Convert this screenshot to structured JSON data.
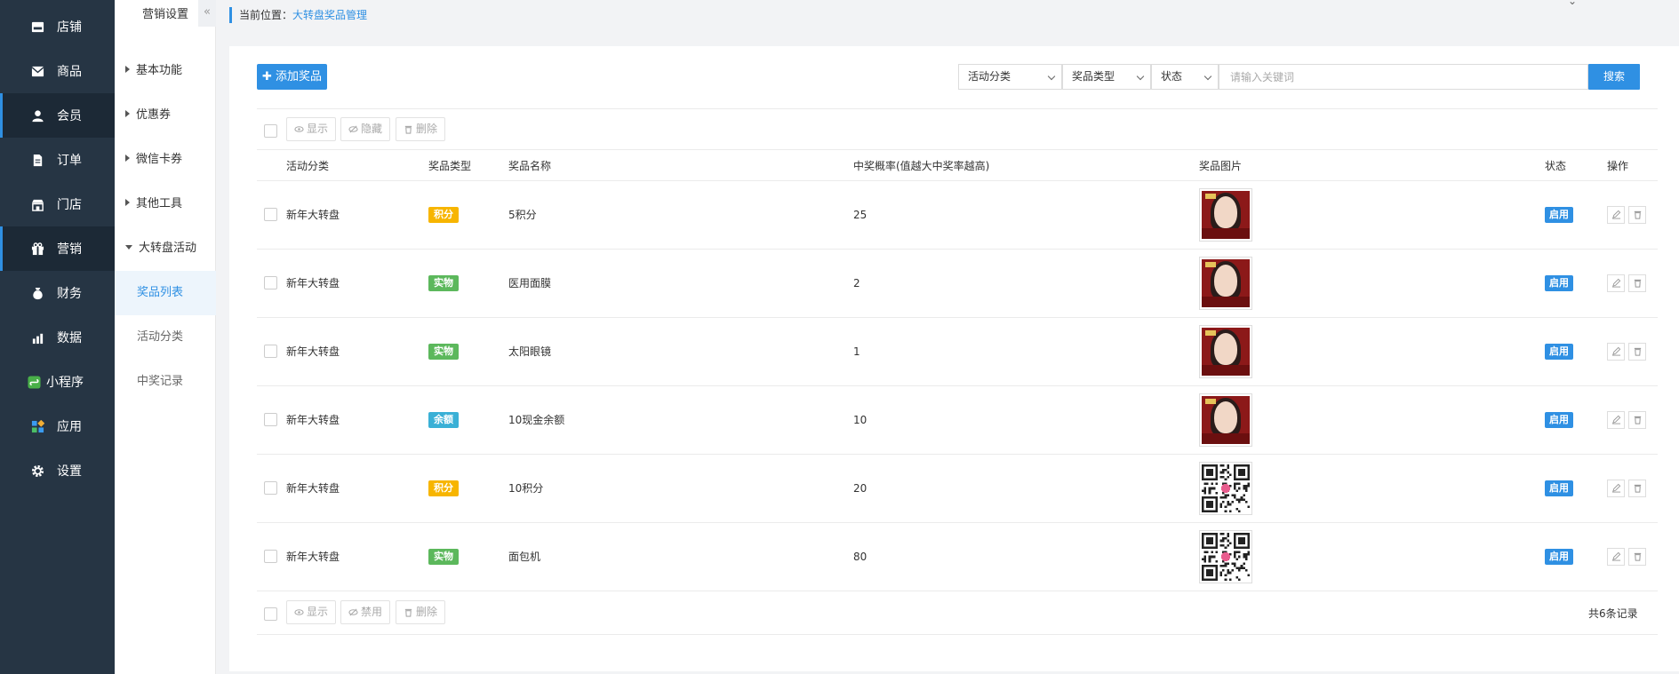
{
  "mainnav": [
    {
      "label": "店铺",
      "icon": "store-icon"
    },
    {
      "label": "商品",
      "icon": "goods-icon"
    },
    {
      "label": "会员",
      "icon": "member-icon"
    },
    {
      "label": "订单",
      "icon": "order-icon"
    },
    {
      "label": "门店",
      "icon": "shop-icon"
    },
    {
      "label": "营销",
      "icon": "gift-icon"
    },
    {
      "label": "财务",
      "icon": "money-bag-icon"
    },
    {
      "label": "数据",
      "icon": "chart-icon"
    },
    {
      "label": "小程序",
      "icon": "miniapp-icon"
    },
    {
      "label": "应用",
      "icon": "apps-icon"
    },
    {
      "label": "设置",
      "icon": "gear-icon"
    }
  ],
  "subnav": {
    "title": "营销设置",
    "collapse": "«",
    "groups": [
      "基本功能",
      "优惠券",
      "微信卡券",
      "其他工具",
      "大转盘活动"
    ],
    "leaves": [
      "奖品列表",
      "活动分类",
      "中奖记录"
    ]
  },
  "breadcrumb": {
    "prefix": "当前位置：",
    "current": "大转盘奖品管理"
  },
  "toolbar": {
    "add_label": "添加奖品",
    "filter_category": "活动分类",
    "filter_type": "奖品类型",
    "filter_status": "状态",
    "search_placeholder": "请输入关键词",
    "search_label": "搜索"
  },
  "batch_top": {
    "show": "显示",
    "hide": "隐藏",
    "delete": "删除"
  },
  "batch_bottom": {
    "show": "显示",
    "disable": "禁用",
    "delete": "删除"
  },
  "columns": {
    "category": "活动分类",
    "type": "奖品类型",
    "name": "奖品名称",
    "rate": "中奖概率(值越大中奖率越高)",
    "image": "奖品图片",
    "status": "状态",
    "actions": "操作"
  },
  "rows": [
    {
      "category": "新年大转盘",
      "type": "积分",
      "type_color": "#f7b500",
      "name": "5积分",
      "rate": "25",
      "image": "portrait",
      "status": "启用"
    },
    {
      "category": "新年大转盘",
      "type": "实物",
      "type_color": "#5cb85c",
      "name": "医用面膜",
      "rate": "2",
      "image": "portrait",
      "status": "启用"
    },
    {
      "category": "新年大转盘",
      "type": "实物",
      "type_color": "#5cb85c",
      "name": "太阳眼镜",
      "rate": "1",
      "image": "portrait",
      "status": "启用"
    },
    {
      "category": "新年大转盘",
      "type": "余额",
      "type_color": "#3ab0d6",
      "name": "10现金余额",
      "rate": "10",
      "image": "portrait",
      "status": "启用"
    },
    {
      "category": "新年大转盘",
      "type": "积分",
      "type_color": "#f7b500",
      "name": "10积分",
      "rate": "20",
      "image": "qrcode",
      "status": "启用"
    },
    {
      "category": "新年大转盘",
      "type": "实物",
      "type_color": "#5cb85c",
      "name": "面包机",
      "rate": "80",
      "image": "qrcode",
      "status": "启用"
    }
  ],
  "total": "共6条记录"
}
